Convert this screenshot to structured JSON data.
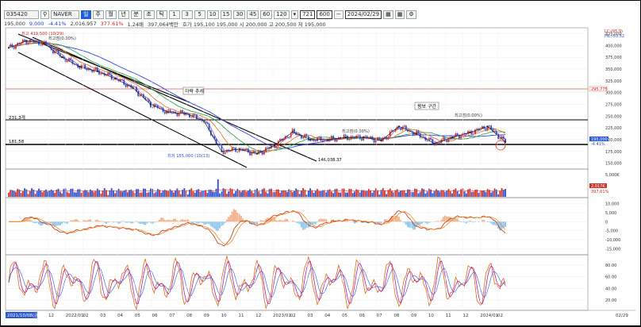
{
  "toolbar": {
    "code": "035420",
    "name": "NAVER",
    "periods": [
      "일",
      "주",
      "월",
      "년",
      "분",
      "초",
      "틱",
      "1",
      "3",
      "5",
      "10",
      "15",
      "30",
      "45",
      "60",
      "120"
    ],
    "count": "721",
    "zoom": "600",
    "date": "2024/02/29"
  },
  "quote": {
    "price": "195,000",
    "change": "9,000",
    "change_pct": "-4.41%",
    "volume": "2,016,957",
    "volume_pct": "377.61%",
    "turnover_ratio": "1.24배",
    "amount": "397,064백만",
    "quote_line": "호가 195,100  195,000  시 200,000  고 200,500  저 195,000"
  },
  "price_panel": {
    "top_right_labels": [
      "LC:(95.9)",
      "HC:-53.52"
    ],
    "y_ticks": [
      "425,000",
      "400,000",
      "375,000",
      "350,000",
      "325,000",
      "300,000",
      "275,000",
      "250,000",
      "225,000",
      "200,000",
      "175,000",
      "150,000"
    ],
    "ref_line_value": "295,775",
    "upper_line_label": "231,3개",
    "lower_line_label": "181,58",
    "current_price_tag": "195,000",
    "current_change_tag": "-4.41%",
    "high_label": "최고 419,500 (10/29)",
    "high_pct": "최고점(0.00%)",
    "low_label": "최저 155,000 (10/13)",
    "trend_label": "하락 추세",
    "range_label": "횡보 구간",
    "trend_end_label": "146,038.37",
    "pct_label_mid": "최고점(0.00%)",
    "pct_label_right": "최고점(0.00%)",
    "pct_label_left": "최고점(0.00%)"
  },
  "volume_panel": {
    "y_ticks": [
      "5,000K"
    ],
    "vol_tag": "2,017K",
    "vol_tag2": "397,61%"
  },
  "macd_panel": {
    "y_ticks": [
      "10,000",
      "5,000",
      "0",
      "-5,000",
      "-10,000",
      "-15,000"
    ]
  },
  "stoch_panel": {
    "y_ticks": [
      "80.00",
      "60.00",
      "40.00",
      "20.00"
    ]
  },
  "x_axis": {
    "left_date": "2021/10/08(금)",
    "right_date": "02/29",
    "labels": [
      "12",
      "2022/01",
      "02",
      "03",
      "04",
      "05",
      "06",
      "07",
      "08",
      "09",
      "10",
      "11",
      "12",
      "2023/01",
      "02",
      "03",
      "04",
      "05",
      "06",
      "07",
      "08",
      "09",
      "10",
      "11",
      "12",
      "2024/01",
      "02"
    ]
  },
  "colors": {
    "up": "#d0302a",
    "down": "#2a4fd0",
    "price_tag": "#2a56d8",
    "vol_tag": "#d0302a"
  },
  "chart_data": {
    "type": "line",
    "title": "",
    "xlabel": "",
    "ylabel": "",
    "ylim": [
      137500,
      437500
    ],
    "x": [
      "2021-10",
      "2021-11",
      "2021-12",
      "2022-01",
      "2022-02",
      "2022-03",
      "2022-04",
      "2022-05",
      "2022-06",
      "2022-07",
      "2022-08",
      "2022-09",
      "2022-10",
      "2022-11",
      "2022-12",
      "2023-01",
      "2023-02",
      "2023-03",
      "2023-04",
      "2023-05",
      "2023-06",
      "2023-07",
      "2023-08",
      "2023-09",
      "2023-10",
      "2023-11",
      "2023-12",
      "2024-01",
      "2024-02"
    ],
    "series": [
      {
        "name": "",
        "values": [
          395000,
          410000,
          405000,
          375000,
          355000,
          345000,
          330000,
          310000,
          275000,
          258000,
          255000,
          240000,
          175000,
          180000,
          170000,
          188000,
          216000,
          200000,
          200000,
          205000,
          205000,
          198000,
          228000,
          212000,
          192000,
          205000,
          215000,
          228000,
          195000
        ]
      }
    ],
    "annotations": [
      "최고 419,500 (10/29)",
      "최저 155,000 (10/13)",
      "하락 추세",
      "횡보 구간",
      "146,038.37"
    ]
  }
}
